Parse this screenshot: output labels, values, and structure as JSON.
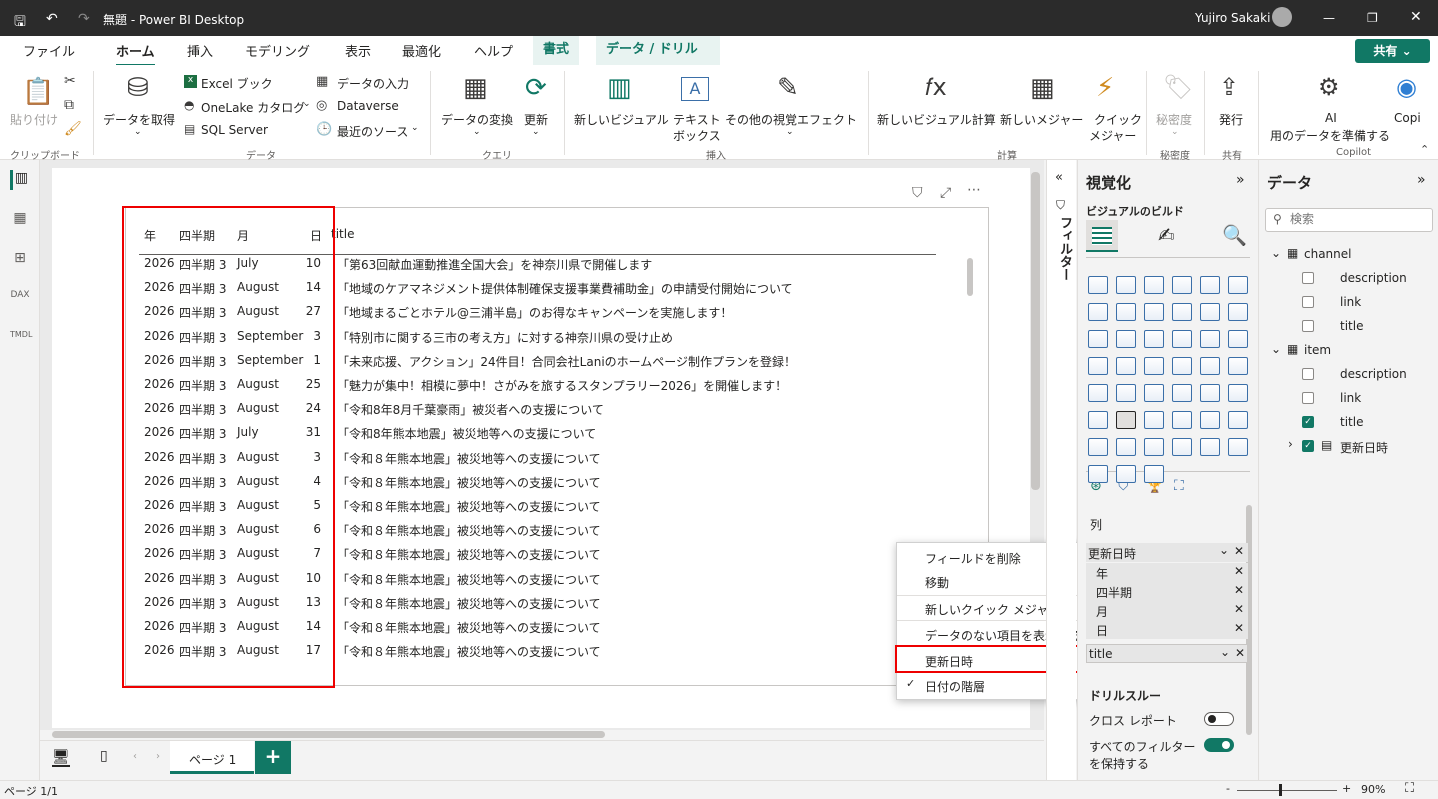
{
  "window": {
    "title": "無題 - Power BI Desktop",
    "user": "Yujiro Sakaki"
  },
  "menu_tabs": [
    "ファイル",
    "ホーム",
    "挿入",
    "モデリング",
    "表示",
    "最適化",
    "ヘルプ",
    "書式",
    "データ / ドリル"
  ],
  "share_label": "共有",
  "ribbon": {
    "paste": "貼り付け",
    "clipboard_group": "クリップボード",
    "get_data": "データを取得",
    "excel": "Excel ブック",
    "onelake": "OneLake カタログ",
    "sql": "SQL Server",
    "enter_data": "データの入力",
    "dataverse": "Dataverse",
    "recent": "最近のソース",
    "data_group": "データ",
    "transform": "データの変換",
    "refresh": "更新",
    "query_group": "クエリ",
    "new_visual": "新しいビジュアル",
    "textbox_1": "テキスト",
    "textbox_2": "ボックス",
    "more_visuals": "その他の視覚エフェクト",
    "insert_group": "挿入",
    "new_visual_calc": "新しいビジュアル計算",
    "new_measure": "新しいメジャー",
    "quick_measure_1": "クイック",
    "quick_measure_2": "メジャー",
    "calc_group": "計算",
    "sensitivity": "秘密度",
    "sensitivity_group": "秘密度",
    "publish": "発行",
    "share_group": "共有",
    "ai_1": "AI",
    "ai_2": "用のデータを準備する",
    "copilot": "Copi",
    "copilot_group": "Copilot"
  },
  "table": {
    "headers": [
      "年",
      "四半期",
      "月",
      "日",
      "title"
    ],
    "rows": [
      [
        "2026",
        "四半期 3",
        "July",
        "10",
        "「第63回献血運動推進全国大会」を神奈川県で開催します"
      ],
      [
        "2026",
        "四半期 3",
        "August",
        "14",
        "「地域のケアマネジメント提供体制確保支援事業費補助金」の申請受付開始について"
      ],
      [
        "2026",
        "四半期 3",
        "August",
        "27",
        "「地域まるごとホテル@三浦半島」のお得なキャンペーンを実施します！"
      ],
      [
        "2026",
        "四半期 3",
        "September",
        "3",
        "「特別市に関する三市の考え方」に対する神奈川県の受け止め"
      ],
      [
        "2026",
        "四半期 3",
        "September",
        "1",
        "「未来応援、アクション」24件目！合同会社Laniのホームページ制作プランを登録！"
      ],
      [
        "2026",
        "四半期 3",
        "August",
        "25",
        "「魅力が集中！相模に夢中！さがみを旅するスタンプラリー2026」を開催します！"
      ],
      [
        "2026",
        "四半期 3",
        "August",
        "24",
        "「令和8年8月千葉豪雨」被災者への支援について"
      ],
      [
        "2026",
        "四半期 3",
        "July",
        "31",
        "「令和8年熊本地震」被災地等への支援について"
      ],
      [
        "2026",
        "四半期 3",
        "August",
        "3",
        "「令和８年熊本地震」被災地等への支援について"
      ],
      [
        "2026",
        "四半期 3",
        "August",
        "4",
        "「令和８年熊本地震」被災地等への支援について"
      ],
      [
        "2026",
        "四半期 3",
        "August",
        "5",
        "「令和８年熊本地震」被災地等への支援について"
      ],
      [
        "2026",
        "四半期 3",
        "August",
        "6",
        "「令和８年熊本地震」被災地等への支援について"
      ],
      [
        "2026",
        "四半期 3",
        "August",
        "7",
        "「令和８年熊本地震」被災地等への支援について"
      ],
      [
        "2026",
        "四半期 3",
        "August",
        "10",
        "「令和８年熊本地震」被災地等への支援について"
      ],
      [
        "2026",
        "四半期 3",
        "August",
        "13",
        "「令和８年熊本地震」被災地等への支援について"
      ],
      [
        "2026",
        "四半期 3",
        "August",
        "14",
        "「令和８年熊本地震」被災地等への支援について"
      ],
      [
        "2026",
        "四半期 3",
        "August",
        "17",
        "「令和８年熊本地震」被災地等への支援について"
      ]
    ]
  },
  "context_menu": {
    "remove_field": "フィールドを削除",
    "move": "移動",
    "new_quick_measure": "新しいクイック メジャー",
    "show_no_data": "データのない項目を表示する",
    "date_field": "更新日時",
    "date_hierarchy": "日付の階層"
  },
  "filter_pane": {
    "label": "フィルター"
  },
  "viz_pane": {
    "title": "視覚化",
    "build_label": "ビジュアルのビルド",
    "columns_label": "列",
    "wells": [
      "更新日時",
      "年",
      "四半期",
      "月",
      "日",
      "title"
    ],
    "drill_label": "ドリルスルー",
    "cross_report": "クロス レポート",
    "keep_filters_1": "すべてのフィルター",
    "keep_filters_2": "を保持する"
  },
  "data_pane": {
    "title": "データ",
    "search_placeholder": "検索",
    "tables": [
      {
        "name": "channel",
        "fields": [
          "description",
          "link",
          "title"
        ]
      },
      {
        "name": "item",
        "fields": [
          "description",
          "link",
          "title",
          "更新日時"
        ]
      }
    ]
  },
  "page_tab": "ページ 1",
  "status": {
    "page": "ページ 1/1",
    "zoom": "90%"
  }
}
